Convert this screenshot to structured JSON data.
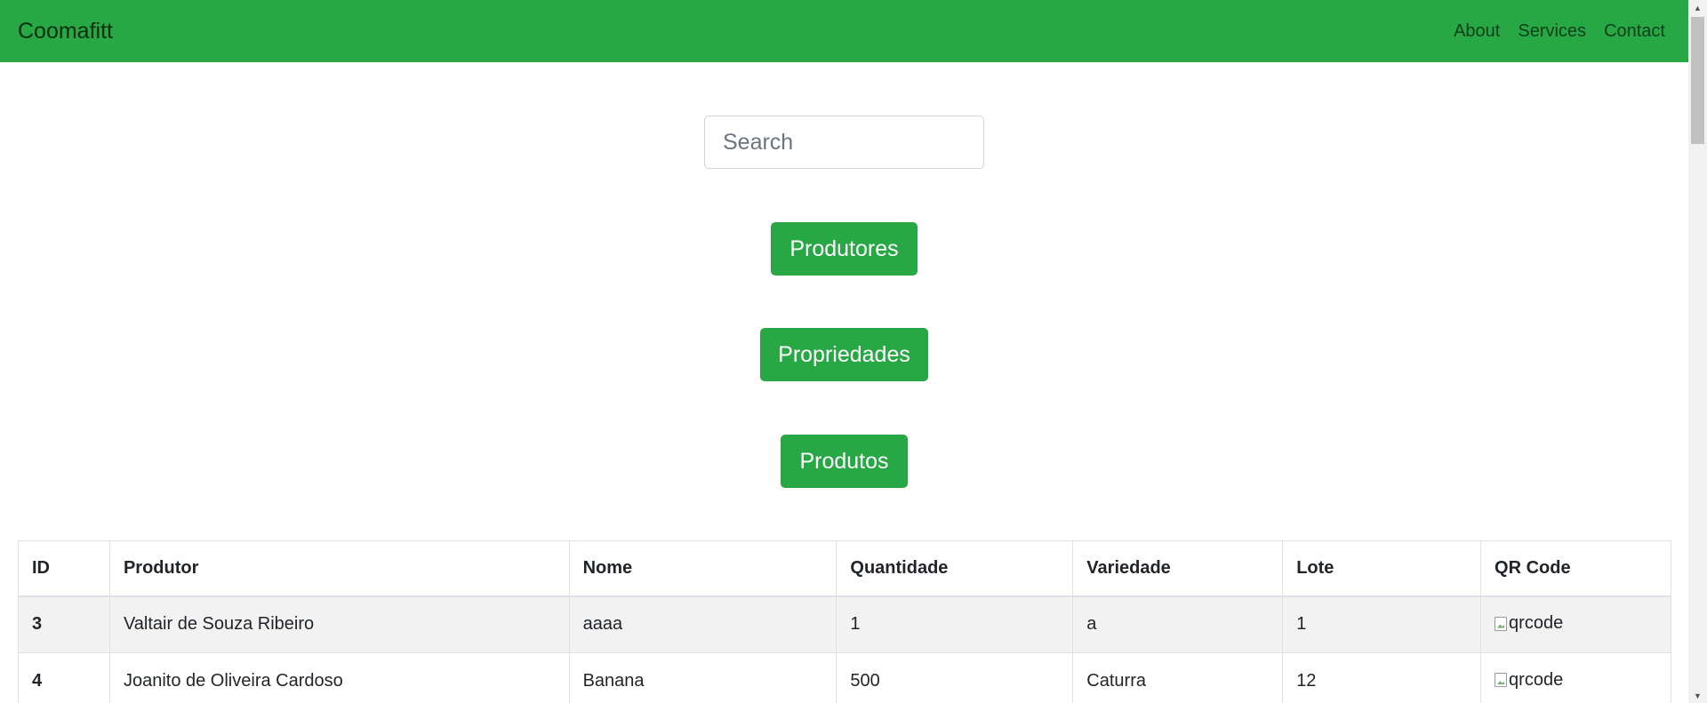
{
  "navbar": {
    "brand": "Coomafitt",
    "links": [
      "About",
      "Services",
      "Contact"
    ]
  },
  "search": {
    "placeholder": "Search",
    "value": ""
  },
  "buttons": {
    "produtores": "Produtores",
    "propriedades": "Propriedades",
    "produtos": "Produtos"
  },
  "table": {
    "headers": [
      "ID",
      "Produtor",
      "Nome",
      "Quantidade",
      "Variedade",
      "Lote",
      "QR Code"
    ],
    "rows": [
      [
        "3",
        "Valtair de Souza Ribeiro",
        "aaaa",
        "1",
        "a",
        "1",
        "qrcode"
      ],
      [
        "4",
        "Joanito de Oliveira Cardoso",
        "Banana",
        "500",
        "Caturra",
        "12",
        "qrcode"
      ]
    ]
  },
  "colors": {
    "brand_green": "#28a745",
    "row_stripe": "#f2f2f2",
    "border": "#dee2e6"
  },
  "icons": {
    "broken_image": "broken-image-icon",
    "scroll_up": "scroll-up-arrow-icon",
    "scroll_down": "scroll-down-arrow-icon"
  }
}
